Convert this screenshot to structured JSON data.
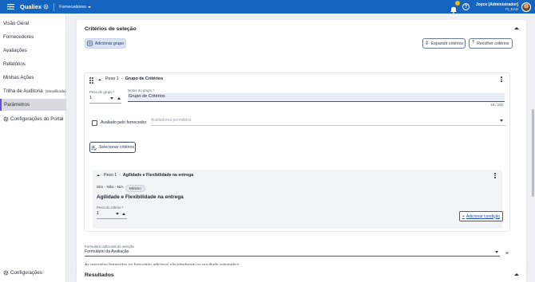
{
  "topbar": {
    "brand": "Qualiex",
    "module": "Fornecedores",
    "user_name": "Joyce [Administrador]",
    "user_company": "FI_EAD"
  },
  "sidebar": {
    "items": [
      {
        "label": "Visão Geral"
      },
      {
        "label": "Fornecedores"
      },
      {
        "label": "Avaliações"
      },
      {
        "label": "Relatórios"
      },
      {
        "label": "Minhas Ações"
      },
      {
        "label": "Trilha de Auditoria",
        "sub": "(Simplificada)"
      },
      {
        "label": "Parâmetros"
      },
      {
        "label": "Configurações do Portal"
      }
    ],
    "bottom_label": "Configurações"
  },
  "criteria": {
    "title": "Critérios de seleção",
    "add_group_label": "Adicionar grupo",
    "expand_label": "Expandir critérios",
    "collapse_label": "Recolher critérios"
  },
  "group": {
    "weight_text": "Peso 1",
    "dash": "-",
    "name_title": "Grupo de Critérios",
    "weight_field_label": "Peso do grupo *",
    "weight_value": "1",
    "name_field_label": "Nome do grupo *",
    "name_value": "Grupo de Critérios",
    "char_count": "18 / 200",
    "evaluated_by_supplier": "Avaliado pelo fornecedor",
    "allowed_evaluators_placeholder": "Avaliadores permitidos",
    "select_criteria_label": "Selecionar critérios"
  },
  "criterion": {
    "weight_text": "Peso 1",
    "dash": "-",
    "name": "Agilidade e Flexibilidade na entrega",
    "scale": "Sim - Não - N/A",
    "tag": "Mínimo",
    "heading": "Agilidade e Flexibilidade na entrega",
    "weight_field_label": "Peso do critério *",
    "weight_value": "1",
    "add_condition_label": "Adicionar condição"
  },
  "form": {
    "label": "Formulário adicional de seleção",
    "value": "Formulário da Avaliação",
    "note": "As respostas fornecidas no formulário adicional não interferem no resultado automático."
  },
  "results": {
    "title": "Resultados"
  },
  "colors": {
    "topbar": "#1565c0",
    "accent": "#6c4bd6",
    "highlight": "#e0202a"
  }
}
